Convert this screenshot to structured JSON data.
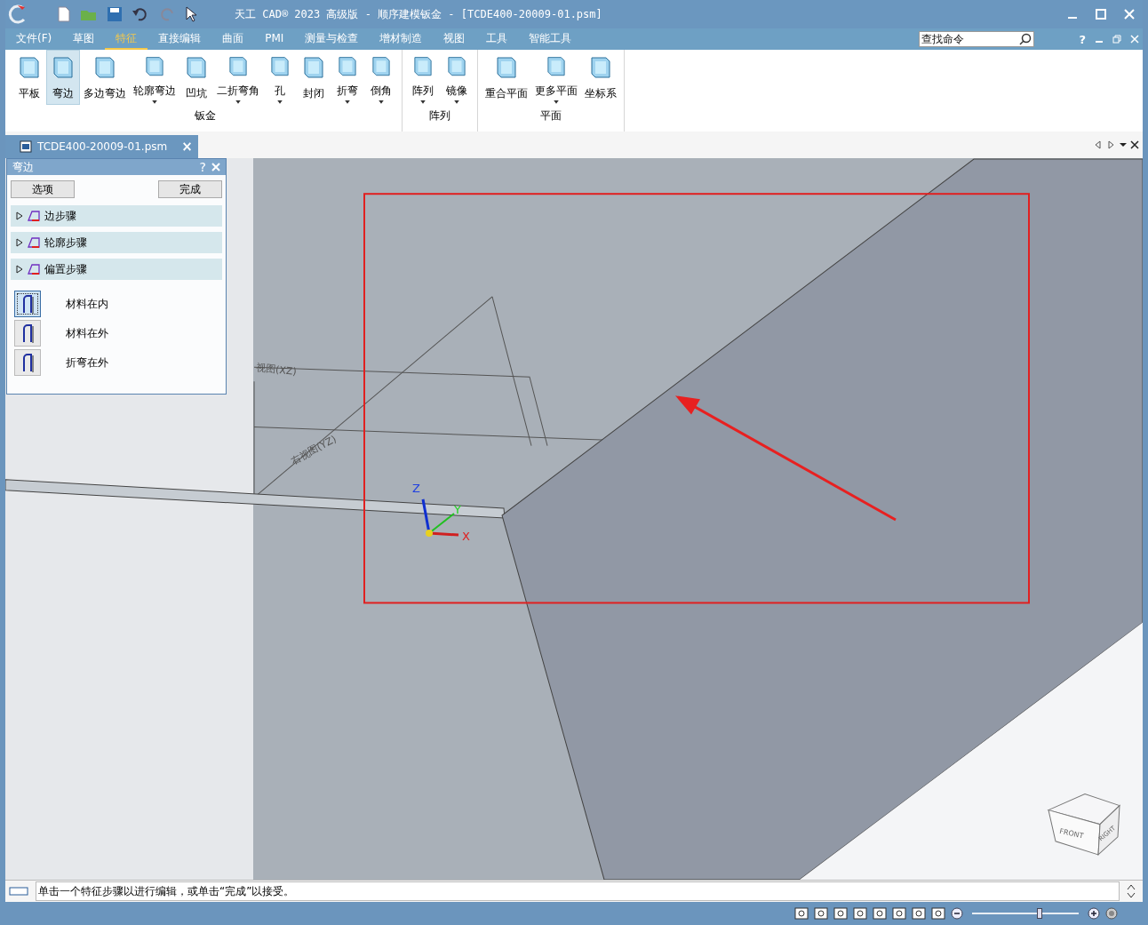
{
  "window": {
    "title": "天工 CAD® 2023 高级版 - 顺序建模钣金 - [TCDE400-20009-01.psm]"
  },
  "menu": [
    {
      "label": "文件(F)",
      "selected": false
    },
    {
      "label": "草图",
      "selected": false
    },
    {
      "label": "特征",
      "selected": true
    },
    {
      "label": "直接编辑",
      "selected": false
    },
    {
      "label": "曲面",
      "selected": false
    },
    {
      "label": "PMI",
      "selected": false
    },
    {
      "label": "测量与检查",
      "selected": false
    },
    {
      "label": "增材制造",
      "selected": false
    },
    {
      "label": "视图",
      "selected": false
    },
    {
      "label": "工具",
      "selected": false
    },
    {
      "label": "智能工具",
      "selected": false
    }
  ],
  "search": {
    "placeholder": "查找命令"
  },
  "help": "?",
  "ribbon": [
    {
      "label": "钣金",
      "items": [
        {
          "label": "平板",
          "selected": false,
          "dropdown": false
        },
        {
          "label": "弯边",
          "selected": true,
          "dropdown": false
        },
        {
          "label": "多边弯边",
          "selected": false,
          "dropdown": false
        },
        {
          "label": "轮廓弯边",
          "selected": false,
          "dropdown": true
        },
        {
          "label": "凹坑",
          "selected": false,
          "dropdown": false
        },
        {
          "label": "二折弯角",
          "selected": false,
          "dropdown": true
        },
        {
          "label": "孔",
          "selected": false,
          "dropdown": true
        },
        {
          "label": "封闭",
          "selected": false,
          "dropdown": false
        },
        {
          "label": "折弯",
          "selected": false,
          "dropdown": true
        },
        {
          "label": "倒角",
          "selected": false,
          "dropdown": true
        }
      ]
    },
    {
      "label": "阵列",
      "items": [
        {
          "label": "阵列",
          "selected": false,
          "dropdown": true
        },
        {
          "label": "镜像",
          "selected": false,
          "dropdown": true
        }
      ]
    },
    {
      "label": "平面",
      "items": [
        {
          "label": "重合平面",
          "selected": false,
          "dropdown": false
        },
        {
          "label": "更多平面",
          "selected": false,
          "dropdown": true
        },
        {
          "label": "坐标系",
          "selected": false,
          "dropdown": false
        }
      ]
    }
  ],
  "document_tab": {
    "label": "TCDE400-20009-01.psm",
    "close": "×"
  },
  "panel": {
    "title": "弯边",
    "help": "?",
    "options_button": "选项",
    "finish_button": "完成",
    "steps": [
      {
        "label": "边步骤",
        "expanded": false
      },
      {
        "label": "轮廓步骤",
        "expanded": false
      },
      {
        "label": "偏置步骤",
        "expanded": false
      }
    ],
    "material_options": [
      {
        "label": "材料在内",
        "selected": true
      },
      {
        "label": "材料在外",
        "selected": false
      },
      {
        "label": "折弯在外",
        "selected": false
      }
    ]
  },
  "viewport": {
    "plane_labels": [
      "视图(XZ)",
      "右视图(YZ)"
    ],
    "axes": [
      "Z",
      "Y",
      "X"
    ],
    "view_cube": [
      "FRONT",
      "RIGHT"
    ]
  },
  "status_bar": {
    "message": "单击一个特征步骤以进行编辑，或单击“完成”以接受。"
  },
  "zoom_slider": {
    "level": 0.63
  }
}
